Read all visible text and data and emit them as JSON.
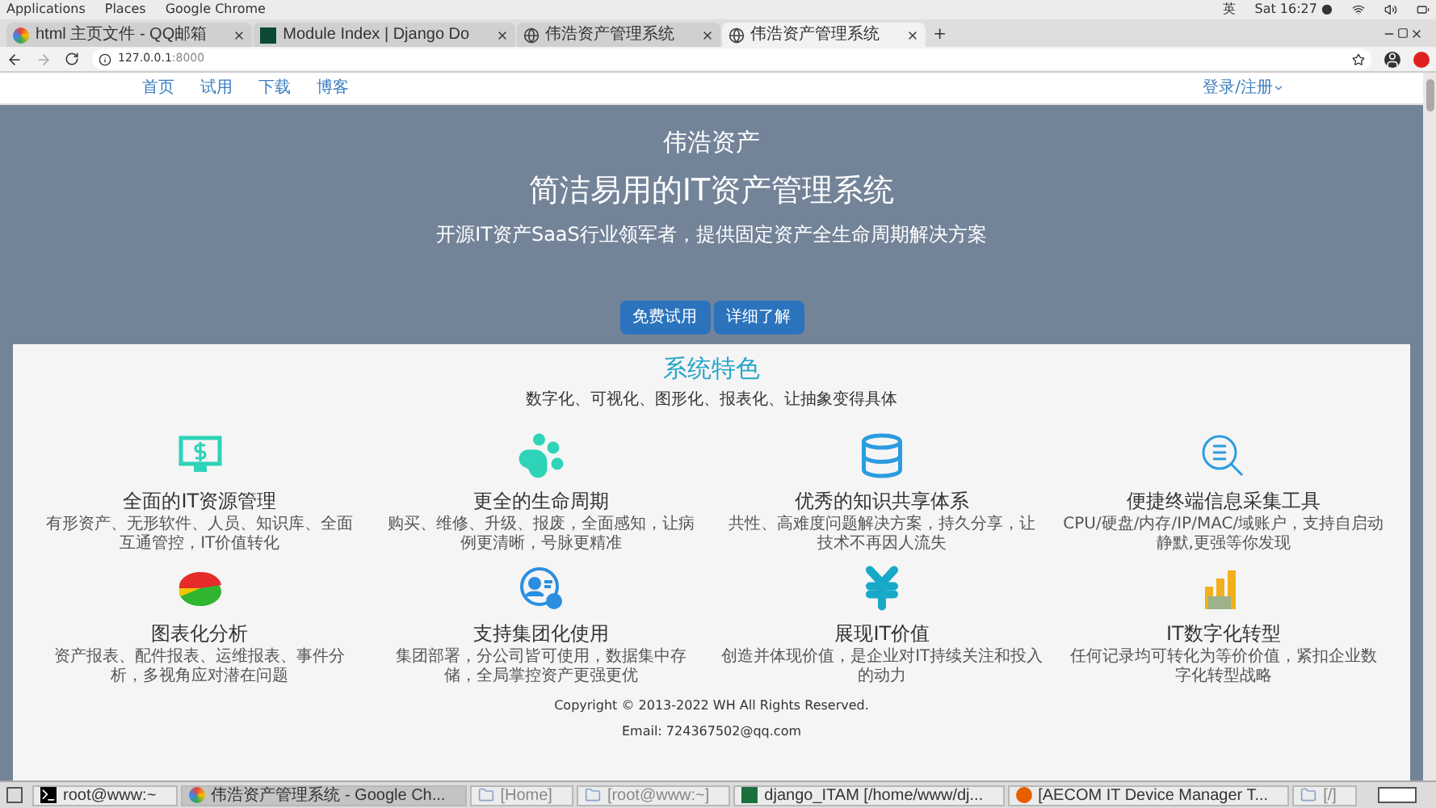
{
  "system_bar": {
    "menus": [
      "Applications",
      "Places",
      "Google Chrome"
    ],
    "input_method": "英",
    "clock": "Sat 16:27 ●"
  },
  "tabs": [
    {
      "title": "html 主页文件 - QQ邮箱",
      "kind": "mail",
      "selected": false
    },
    {
      "title": "Module Index | Django Do",
      "kind": "django",
      "selected": false
    },
    {
      "title": "伟浩资产管理系统",
      "kind": "globe",
      "selected": false
    },
    {
      "title": "伟浩资产管理系统",
      "kind": "globe",
      "selected": true
    }
  ],
  "tab_new": "+",
  "address": {
    "host": "127.0.0.1",
    "port": ":8000"
  },
  "nav": {
    "links": [
      "首页",
      "试用",
      "下载",
      "博客"
    ],
    "login": "登录/注册"
  },
  "hero": {
    "brand": "伟浩资产",
    "title": "简洁易用的IT资产管理系统",
    "subtitle": "开源IT资产SaaS行业领军者，提供固定资产全生命周期解决方案",
    "buttons": [
      "免费试用",
      "详细了解"
    ]
  },
  "features_section": {
    "title": "系统特色",
    "subtitle": "数字化、可视化、图形化、报表化、让抽象变得具体"
  },
  "features": [
    {
      "kind": "monitor",
      "title": "全面的IT资源管理",
      "description": "有形资产、无形软件、人员、知识库、全面互通管控，IT价值转化"
    },
    {
      "kind": "paw",
      "title": "更全的生命周期",
      "description": "购买、维修、升级、报废，全面感知，让病例更清晰，号脉更精准"
    },
    {
      "kind": "database",
      "title": "优秀的知识共享体系",
      "description": "共性、高难度问题解决方案，持久分享，让技术不再因人流失"
    },
    {
      "kind": "search",
      "title": "便捷终端信息采集工具",
      "description": "CPU/硬盘/内存/IP/MAC/域账户，支持自启动静默,更强等你发现"
    },
    {
      "kind": "pie",
      "title": "图表化分析",
      "description": "资产报表、配件报表、运维报表、事件分析，多视角应对潜在问题"
    },
    {
      "kind": "user",
      "title": "支持集团化使用",
      "description": "集团部署，分公司皆可使用，数据集中存储，全局掌控资产更强更优"
    },
    {
      "kind": "yen",
      "title": "展现IT价值",
      "description": "创造并体现价值，是企业对IT持续关注和投入的动力"
    },
    {
      "kind": "bars",
      "title": "IT数字化转型",
      "description": "任何记录均可转化为等价价值，紧扣企业数字化转型战略"
    }
  ],
  "footer": {
    "copyright": "Copyright © 2013-2022 WH All Rights Reserved.",
    "email": "Email: 724367502@qq.com"
  },
  "taskbar": [
    {
      "label": "root@www:~",
      "kind": "terminal",
      "selected": false
    },
    {
      "label": "伟浩资产管理系统 - Google Ch...",
      "kind": "chrome",
      "selected": true
    },
    {
      "label": "[Home]",
      "kind": "folder",
      "selected": false
    },
    {
      "label": "[root@www:~]",
      "kind": "folder",
      "selected": false
    },
    {
      "label": "django_ITAM [/home/www/dj...",
      "kind": "ide",
      "selected": false
    },
    {
      "label": "[AECOM IT Device Manager T...",
      "kind": "firefox",
      "selected": false
    },
    {
      "label": "[/]",
      "kind": "folder",
      "selected": false
    }
  ]
}
